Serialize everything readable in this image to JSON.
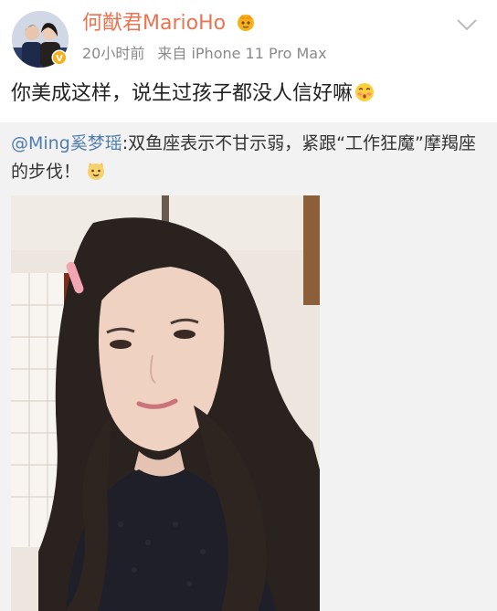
{
  "post": {
    "author_name": "何猷君MarioHo",
    "time": "20小时前",
    "source": "来自 iPhone 11 Pro Max",
    "text": "你美成这样，说生过孩子都没人信好嘛",
    "icons": {
      "avatar": "avatar",
      "verified": "verified-badge-icon",
      "vip": "vip-crown-icon",
      "more": "chevron-down-icon",
      "text_emoji": "shy-face-emoji-icon"
    }
  },
  "repost": {
    "mention": "@Ming奚梦瑶",
    "text": ":双鱼座表示不甘示弱，紧跟“工作狂魔”摩羯座的步伐！",
    "icons": {
      "emoji": "cat-face-emoji-icon",
      "photo": "selfie-photo"
    }
  },
  "colors": {
    "username": "#eb7350",
    "mention": "#507daf",
    "meta": "#8a8a8a",
    "repost_background": "#f2f2f2"
  }
}
